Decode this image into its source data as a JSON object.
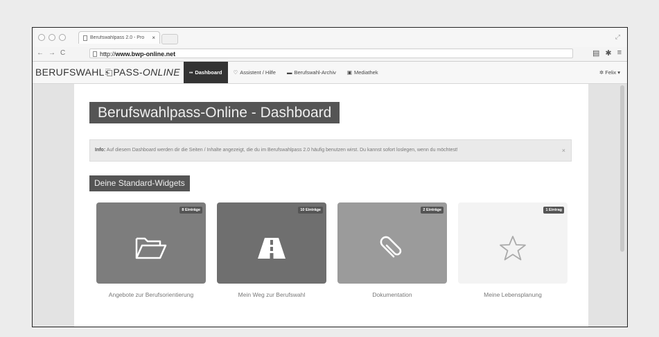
{
  "browser": {
    "tab_title": "Berufswahlpass 2.0 - Pro",
    "tab_close": "×",
    "url_protocol": "http://",
    "url_host": "www.bwp-online.net"
  },
  "navbar": {
    "brand_part1": "BERUFSWAHL",
    "brand_part2": "PASS-",
    "brand_part3": "ONLINE",
    "items": [
      {
        "icon": "grid-icon",
        "label": "Dashboard",
        "active": true
      },
      {
        "icon": "lightbulb-icon",
        "label": "Assistent / Hilfe",
        "active": false
      },
      {
        "icon": "folder-icon",
        "label": "Berufswahl-Archiv",
        "active": false
      },
      {
        "icon": "image-icon",
        "label": "Mediathek",
        "active": false
      }
    ],
    "user_label": "Felix"
  },
  "page": {
    "title": "Berufswahlpass-Online - Dashboard",
    "info_label": "Info:",
    "info_text": "Auf diesem Dashboard werden dir die Seiten / Inhalte angezeigt, die du im Berufswahlpass 2.0 häufig benutzen wirst. Du kannst sofort loslegen, wenn du möchtest!",
    "info_close": "×",
    "section_title": "Deine Standard-Widgets"
  },
  "widgets": [
    {
      "badge": "8 Einträge",
      "label": "Angebote zur Berufsorientierung",
      "icon": "folder-open-icon",
      "color": "#7d7d7d"
    },
    {
      "badge": "10 Einträge",
      "label": "Mein Weg zur Berufswahl",
      "icon": "road-icon",
      "color": "#6f6f6f"
    },
    {
      "badge": "2 Einträge",
      "label": "Dokumentation",
      "icon": "paperclip-icon",
      "color": "#9b9b9b"
    },
    {
      "badge": "1 Eintrag",
      "label": "Meine Lebensplanung",
      "icon": "star-icon",
      "color": "#f3f3f3"
    }
  ]
}
